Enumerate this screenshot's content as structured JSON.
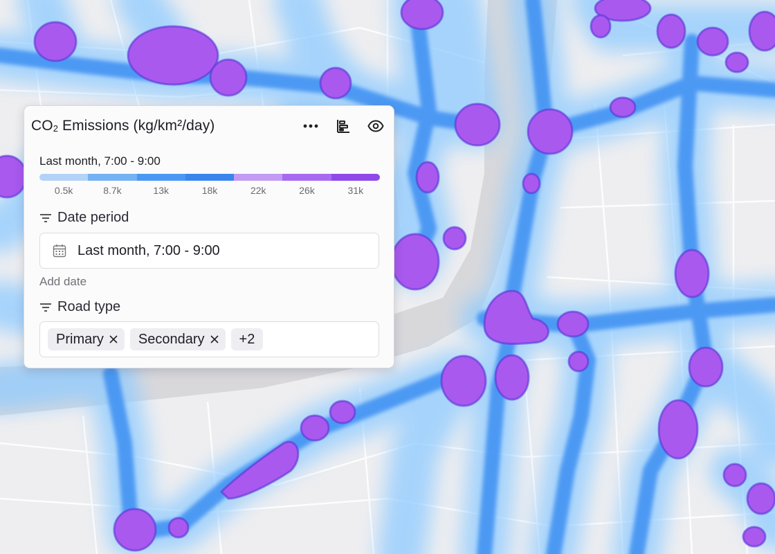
{
  "panel": {
    "title_prefix": "CO",
    "title_sub": "2",
    "title_suffix": " Emissions (kg/km²/day)",
    "header_icons": [
      "more-options-icon",
      "chart-icon",
      "visibility-eye-icon"
    ]
  },
  "legend": {
    "label": "Last month, 7:00 - 9:00",
    "ticks": [
      "0.5k",
      "8.7k",
      "13k",
      "18k",
      "22k",
      "26k",
      "31k"
    ],
    "colors": [
      "#b3d2f7",
      "#73b2f3",
      "#4a98f3",
      "#3a86ec",
      "#c39af4",
      "#a86af0",
      "#8f49e8"
    ]
  },
  "filters": {
    "date": {
      "label": "Date period",
      "value": "Last month, 7:00 - 9:00",
      "add_label": "Add date"
    },
    "road": {
      "label": "Road type",
      "chips": [
        "Primary",
        "Secondary"
      ],
      "more": "+2"
    }
  },
  "map": {
    "heat_colors": {
      "low": "#8ecbff",
      "mid": "#2f86f2",
      "high": "#a959ee"
    },
    "base_colors": {
      "land": "#eeeef0",
      "river": "#d7d7da",
      "street": "#ffffff"
    }
  }
}
